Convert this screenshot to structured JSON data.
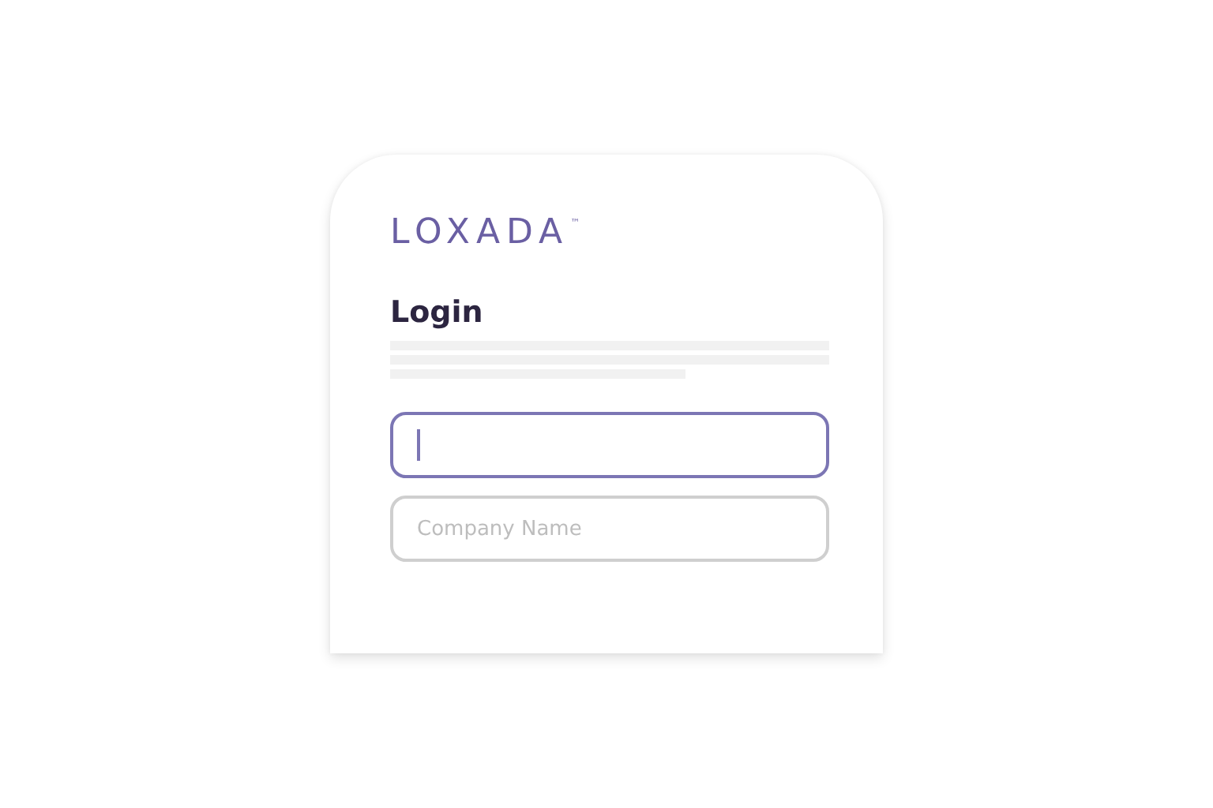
{
  "logo": {
    "text": "LOXADA",
    "mark": "™"
  },
  "heading": "Login",
  "fields": [
    {
      "focused": true
    },
    {
      "placeholder": "Company Name",
      "focused": false
    }
  ]
}
